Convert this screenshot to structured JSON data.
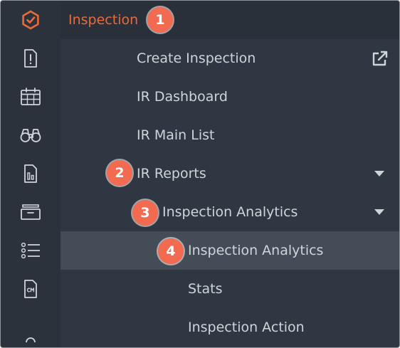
{
  "header": {
    "title": "Inspection",
    "badge": "1"
  },
  "menu": {
    "create_inspection": "Create Inspection",
    "ir_dashboard": "IR Dashboard",
    "ir_main_list": "IR Main List",
    "ir_reports": "IR Reports",
    "inspection_analytics_group": "Inspection Analytics",
    "inspection_analytics_item": "Inspection Analytics",
    "stats": "Stats",
    "inspection_action": "Inspection Action"
  },
  "badges": {
    "ir_reports": "2",
    "inspection_analytics_group": "3",
    "inspection_analytics_item": "4"
  },
  "rail_icons": [
    "app-logo-icon",
    "alert-document-icon",
    "calendar-icon",
    "binoculars-icon",
    "report-chart-icon",
    "archive-box-icon",
    "list-icon",
    "cm-document-icon"
  ],
  "colors": {
    "accent": "#ea6a3a",
    "badge": "#f26a4f",
    "panel_bg": "#2f3742",
    "rail_bg": "#2b323b",
    "active_row": "#434c57",
    "text": "#d0d4d9"
  }
}
